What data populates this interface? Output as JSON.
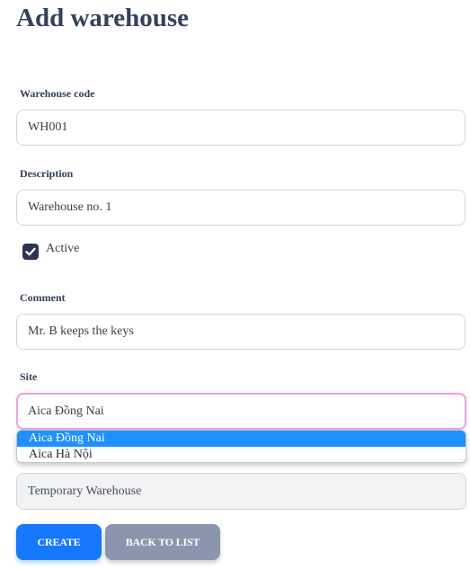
{
  "page": {
    "title": "Add warehouse"
  },
  "form": {
    "warehouse_code": {
      "label": "Warehouse code",
      "value": "WH001"
    },
    "description": {
      "label": "Description",
      "value": "Warehouse no. 1"
    },
    "active": {
      "label": "Active",
      "checked": true
    },
    "comment": {
      "label": "Comment",
      "value": "Mr. B keeps the keys"
    },
    "site": {
      "label": "Site",
      "value": "Aica Đồng Nai",
      "options": [
        "Aica Đồng Nai",
        "Aica Hà Nội"
      ]
    },
    "type_value": "Temporary Warehouse"
  },
  "buttons": {
    "create": "CREATE",
    "back": "BACK TO LIST"
  },
  "colors": {
    "primary": "#1677ff",
    "secondary": "#8996ae",
    "checkbox": "#2c3550",
    "focus_border": "#e4a6dc",
    "selected_option": "#1e90ff"
  }
}
